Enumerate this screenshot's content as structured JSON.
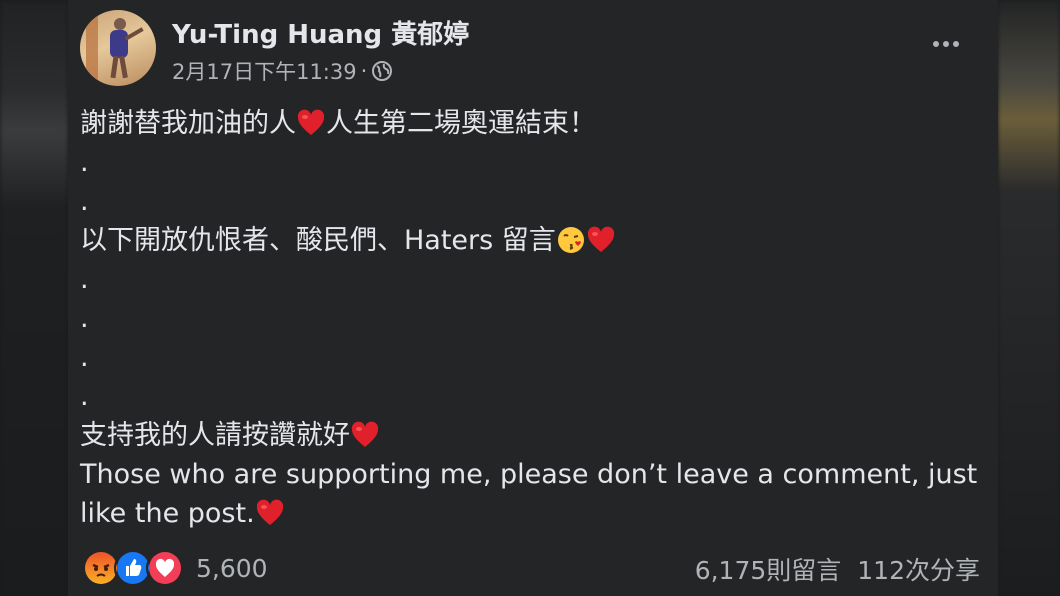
{
  "author": {
    "name": "Yu-Ting Huang 黃郁婷",
    "timestamp": "2月17日下午11:39",
    "separator": "·",
    "privacy_icon": "globe-icon"
  },
  "menu_icon": "more-options-icon",
  "post": {
    "line1": "謝謝替我加油的人",
    "line1b": "人生第二場奧運結束！",
    "dot": ".",
    "line2": "以下開放仇恨者、酸民們、Haters 留言",
    "line3": "支持我的人請按讚就好",
    "line4": "Those who are supporting me, please don’t leave a comment, just like the post."
  },
  "reactions": {
    "icons": [
      "angry-reaction-icon",
      "like-reaction-icon",
      "love-reaction-icon"
    ],
    "count": "5,600"
  },
  "stats": {
    "comments": "6,175則留言",
    "shares": "112次分享"
  },
  "colors": {
    "card_bg": "#242526",
    "text": "#e4e6eb",
    "secondary": "#b0b3b8",
    "like_blue": "#1877f2",
    "love_red": "#f33e58",
    "angry_orange": "#e9710f"
  }
}
